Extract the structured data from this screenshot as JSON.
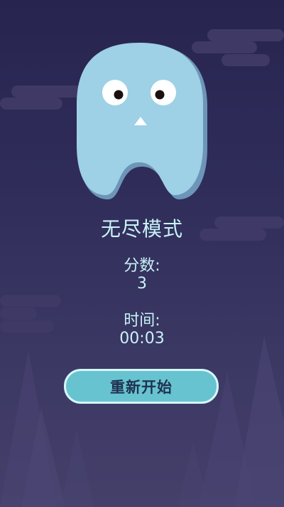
{
  "game": {
    "mode_title": "无尽模式",
    "score_label": "分数:",
    "score_value": "3",
    "time_label": "时间:",
    "time_value": "00:03",
    "restart_label": "重新开始"
  },
  "colors": {
    "background_top": "#27254f",
    "background_bottom": "#45406a",
    "ghost_body": "#9ed0e6",
    "ghost_outline": "#6d95b8",
    "text": "#c9f2f6",
    "button_fill": "#67c3cf",
    "button_border": "#d6f7fb",
    "button_text": "#1f3150"
  }
}
